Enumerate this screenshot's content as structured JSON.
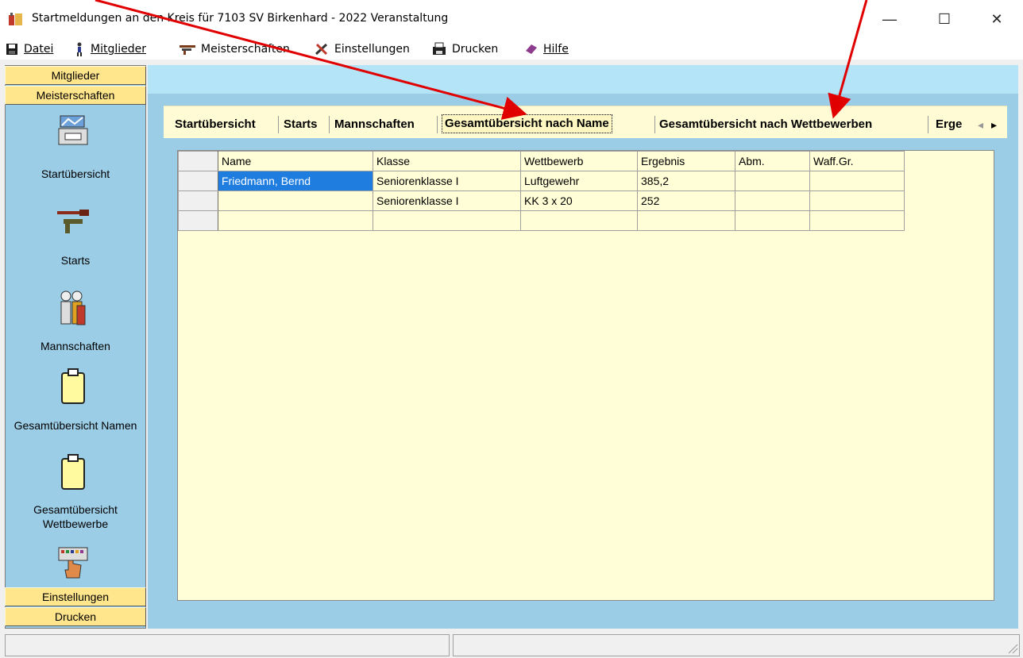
{
  "window": {
    "title": "Startmeldungen an den Kreis für 7103 SV Birkenhard - 2022   Veranstaltung",
    "minimize": "—",
    "maximize": "☐",
    "close": "✕"
  },
  "menu": [
    {
      "label": "Datei",
      "icon": "floppy-disk-icon"
    },
    {
      "label": "Mitglieder",
      "icon": "person-icon"
    },
    {
      "label": "Meisterschaften",
      "icon": "rifle-icon"
    },
    {
      "label": "Einstellungen",
      "icon": "tools-icon"
    },
    {
      "label": "Drucken",
      "icon": "printer-icon"
    },
    {
      "label": "Hilfe",
      "icon": "book-icon"
    }
  ],
  "sidebar": {
    "top_buttons": [
      "Mitglieder",
      "Meisterschaften"
    ],
    "items": [
      {
        "label": "Startübersicht",
        "icon": "start-overview-icon"
      },
      {
        "label": "Starts",
        "icon": "guns-icon"
      },
      {
        "label": "Mannschaften",
        "icon": "team-icon"
      },
      {
        "label": "Gesamtübersicht Namen",
        "icon": "clipboard-icon"
      },
      {
        "label": "Gesamtübersicht Wettbewerbe",
        "icon": "clipboard-icon"
      },
      {
        "label": "",
        "icon": "keyboard-hand-icon"
      }
    ],
    "bottom_buttons": [
      "Einstellungen",
      "Drucken"
    ]
  },
  "tabs": [
    {
      "label": "Startübersicht",
      "active": false
    },
    {
      "label": "Starts",
      "active": false
    },
    {
      "label": "Mannschaften",
      "active": false
    },
    {
      "label": "Gesamtübersicht nach Name",
      "active": true
    },
    {
      "label": "Gesamtübersicht nach Wettbewerben",
      "active": false
    },
    {
      "label": "Erge",
      "active": false
    }
  ],
  "tab_scroll": {
    "left": "◂",
    "right": "▸"
  },
  "grid": {
    "columns": [
      "Name",
      "Klasse",
      "Wettbewerb",
      "Ergebnis",
      "Abm.",
      "Waff.Gr."
    ],
    "rows": [
      [
        "Friedmann, Bernd",
        "Seniorenklasse I",
        "Luftgewehr",
        "385,2",
        "",
        ""
      ],
      [
        "",
        "Seniorenklasse I",
        "KK 3 x 20",
        "252",
        "",
        ""
      ],
      [
        "",
        "",
        "",
        "",
        "",
        ""
      ]
    ]
  },
  "colors": {
    "sidebar_bg": "#9ccde6",
    "button_yellow": "#ffe58c",
    "panel_bg": "#fffed6",
    "selection": "#1f7de0",
    "annotation_arrow": "#e00000"
  }
}
